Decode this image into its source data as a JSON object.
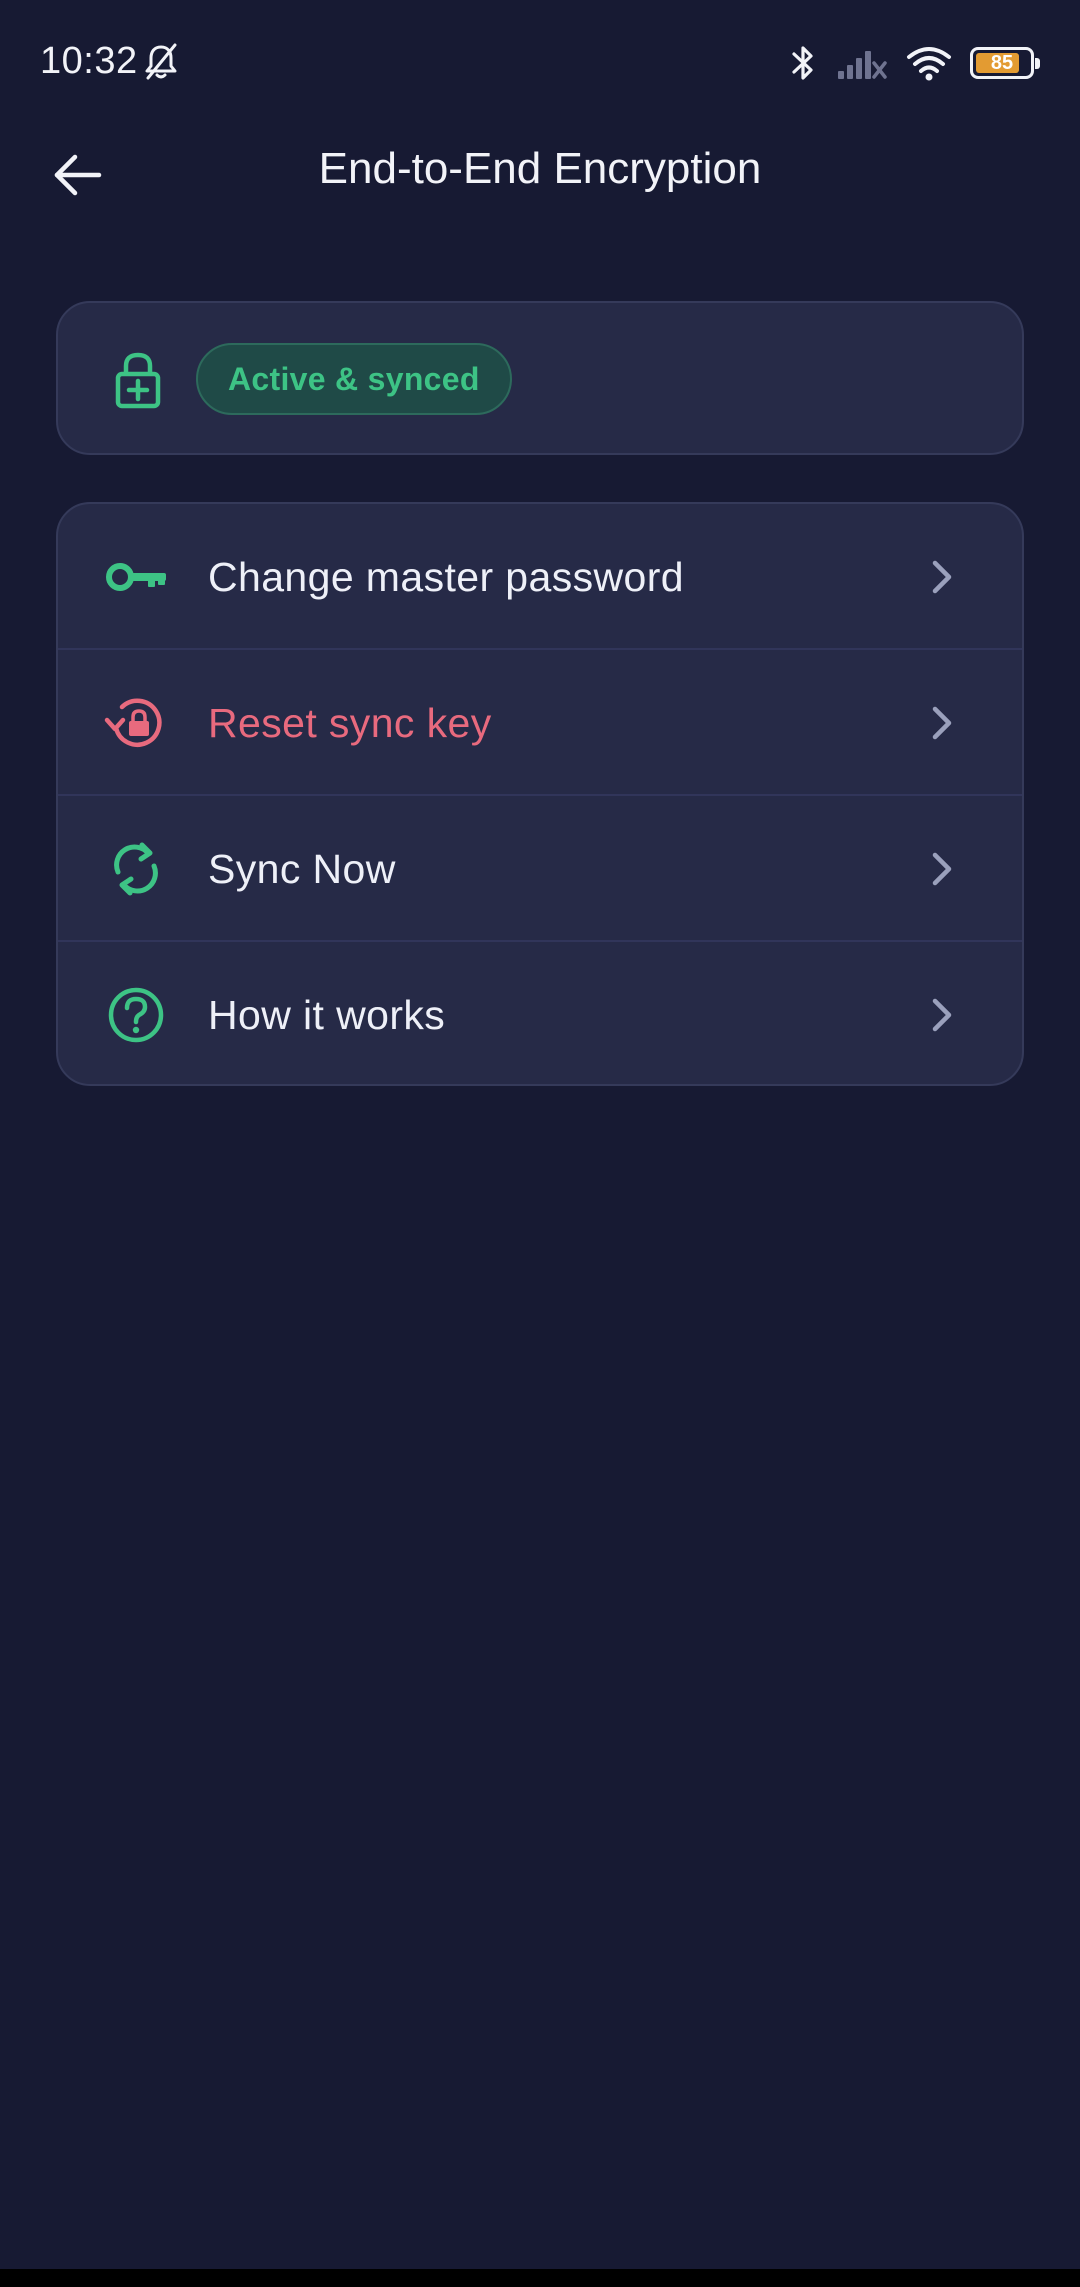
{
  "status_bar": {
    "time": "10:32",
    "battery_level": "85",
    "icons": [
      "bell-off-icon",
      "bluetooth-icon",
      "signal-off-icon",
      "wifi-icon",
      "battery-icon"
    ]
  },
  "app_bar": {
    "title": "End-to-End Encryption",
    "back_icon": "arrow-left-icon"
  },
  "status_card": {
    "icon": "lock-plus-icon",
    "badge_label": "Active & synced"
  },
  "menu": {
    "items": [
      {
        "label": "Change master password",
        "icon": "key-icon",
        "variant": "default"
      },
      {
        "label": "Reset sync key",
        "icon": "reset-lock-icon",
        "variant": "danger"
      },
      {
        "label": "Sync Now",
        "icon": "sync-icon",
        "variant": "default"
      },
      {
        "label": "How it works",
        "icon": "help-circle-icon",
        "variant": "default"
      }
    ]
  },
  "colors": {
    "background": "#171a33",
    "card": "#262a47",
    "accent_green": "#3dc385",
    "danger_red": "#e86a7e",
    "battery_orange": "#e39b32",
    "text_primary": "#eef0f8",
    "chevron": "#9aa0bc"
  }
}
